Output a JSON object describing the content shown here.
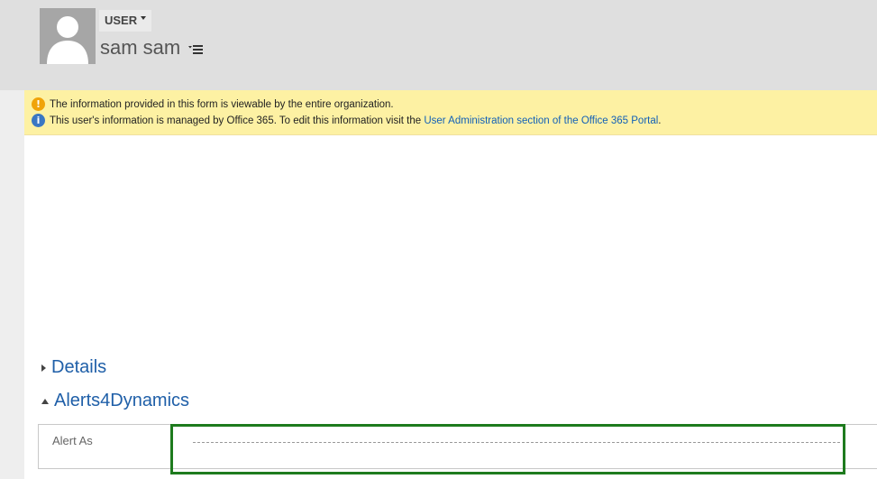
{
  "header": {
    "entity_type": "USER",
    "record_name": "sam sam"
  },
  "notifications": {
    "warning_text": "The information provided in this form is viewable by the entire organization.",
    "info_text_prefix": "This user's information is managed by Office 365. To edit this information visit the ",
    "info_link_text": "User Administration section of the Office 365 Portal",
    "info_text_suffix": ".",
    "warning_color": "#f0a30a",
    "info_color": "#3a77c3"
  },
  "sections": {
    "details_label": "Details",
    "alerts_label": "Alerts4Dynamics"
  },
  "form": {
    "alert_as_label": "Alert As",
    "alert_as_value": ""
  },
  "colors": {
    "header_bg": "#dfdfdf",
    "notification_bg": "#fdf1a3",
    "section_title": "#1f5fa8",
    "highlight_border": "#1e7b1e"
  }
}
